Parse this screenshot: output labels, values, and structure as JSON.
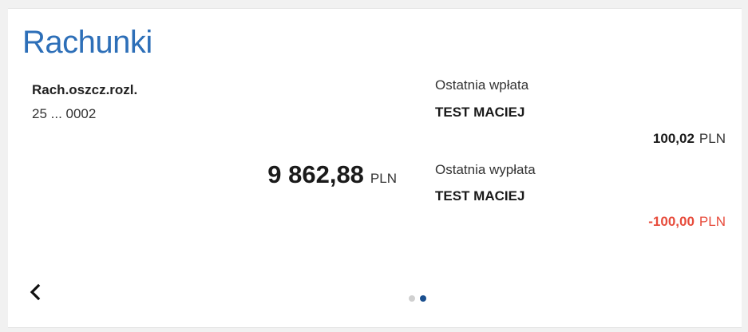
{
  "section": {
    "title": "Rachunki"
  },
  "account": {
    "name": "Rach.oszcz.rozl.",
    "number": "25 ... 0002",
    "balance": "9 862,88",
    "balance_currency": "PLN"
  },
  "last_deposit": {
    "label": "Ostatnia wpłata",
    "name": "TEST MACIEJ",
    "amount": "100,02",
    "currency": "PLN"
  },
  "last_withdrawal": {
    "label": "Ostatnia wypłata",
    "name": "TEST MACIEJ",
    "amount": "-100,00",
    "currency": "PLN"
  },
  "carousel": {
    "pages": 2,
    "active_page": 2
  },
  "colors": {
    "title": "#2d6fb8",
    "negative": "#e74c3c",
    "dot_active": "#1a4f8f",
    "dot_inactive": "#d0d0d0"
  },
  "icons": {
    "prev": "chevron-left-icon"
  }
}
